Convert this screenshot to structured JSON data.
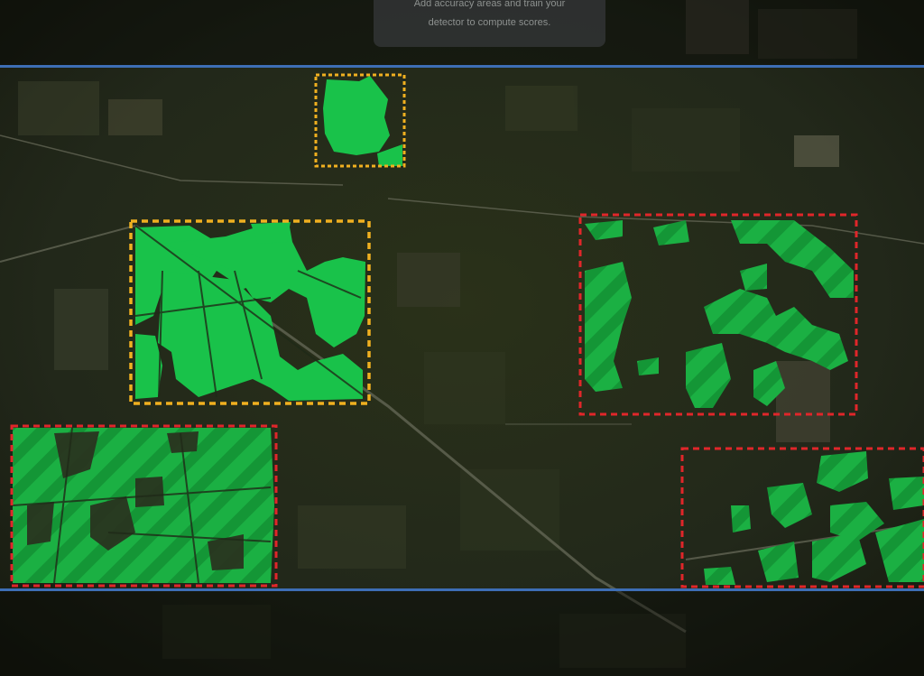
{
  "tooltip": {
    "line1": "Add accuracy areas and train your",
    "line2": "detector to compute scores."
  },
  "colors": {
    "detection_fill": "#19c24a",
    "selected_border": "#f0b020",
    "accuracy_border": "#e0262a",
    "band_line": "#3d6eb5"
  },
  "icons": [
    "accuracy-area-yellow",
    "accuracy-area-red"
  ]
}
